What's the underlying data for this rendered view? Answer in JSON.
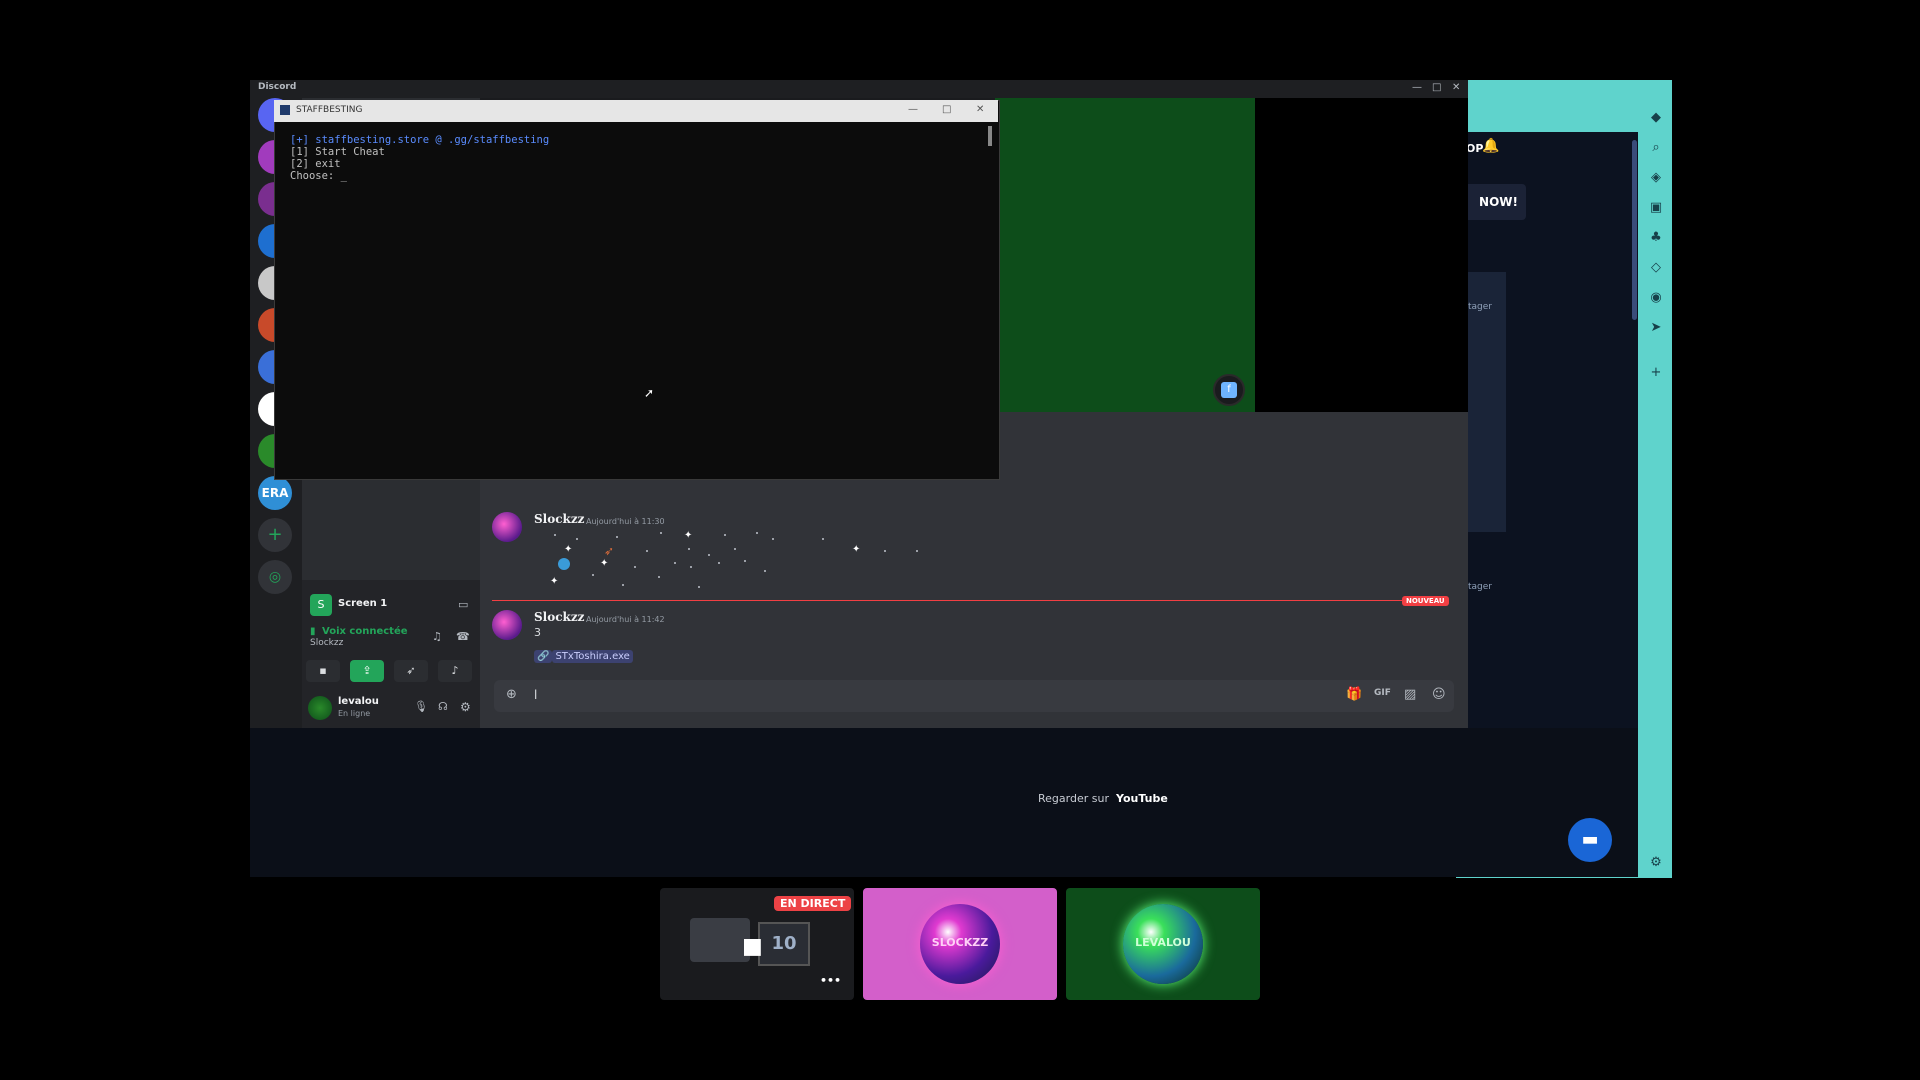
{
  "discord": {
    "title": "Discord",
    "servers": [
      {
        "name": "server-1",
        "color": "#5865f2"
      },
      {
        "name": "server-2",
        "color": "#a13bbd"
      },
      {
        "name": "server-3",
        "color": "#7a2e8f"
      },
      {
        "name": "server-4",
        "color": "#1e6fd0"
      },
      {
        "name": "server-5",
        "color": "#c8c8c8"
      },
      {
        "name": "server-6",
        "color": "#c84a2a"
      },
      {
        "name": "server-7",
        "color": "#3a6fd8"
      },
      {
        "name": "server-8",
        "color": "#ffffff"
      },
      {
        "name": "server-9",
        "color": "#2a8a2a"
      }
    ],
    "era_label": "ERA",
    "voice": {
      "stream_name": "Screen 1",
      "status": "Voix connectée",
      "channel": "Slockzz"
    },
    "user": {
      "name": "levalou",
      "status": "En ligne"
    },
    "messages": [
      {
        "author": "Slockzz",
        "timestamp": "Aujourd'hui à 11:30"
      },
      {
        "author": "Slockzz",
        "timestamp": "Aujourd'hui à 11:42",
        "text": "3",
        "mention": "STxToshira.exe"
      }
    ],
    "new_badge": "NOUVEAU",
    "composer_value": "l"
  },
  "terminal": {
    "title": "STAFFBESTING",
    "lines": [
      "[+] staffbesting.store @ .gg/staffbesting",
      "[1] Start Cheat",
      "[2] exit",
      "Choose: _"
    ]
  },
  "browser": {
    "top_text": "OP",
    "now_text": "NOW!",
    "youtube_text": "Regarder sur",
    "youtube_brand": "YouTube",
    "partager_1": "tager",
    "partager_2": "tager"
  },
  "tiles": {
    "live_label": "EN DIRECT",
    "tile2_label": "SLOCKZZ",
    "tile3_label": "LEVALOU",
    "more": "•••"
  }
}
